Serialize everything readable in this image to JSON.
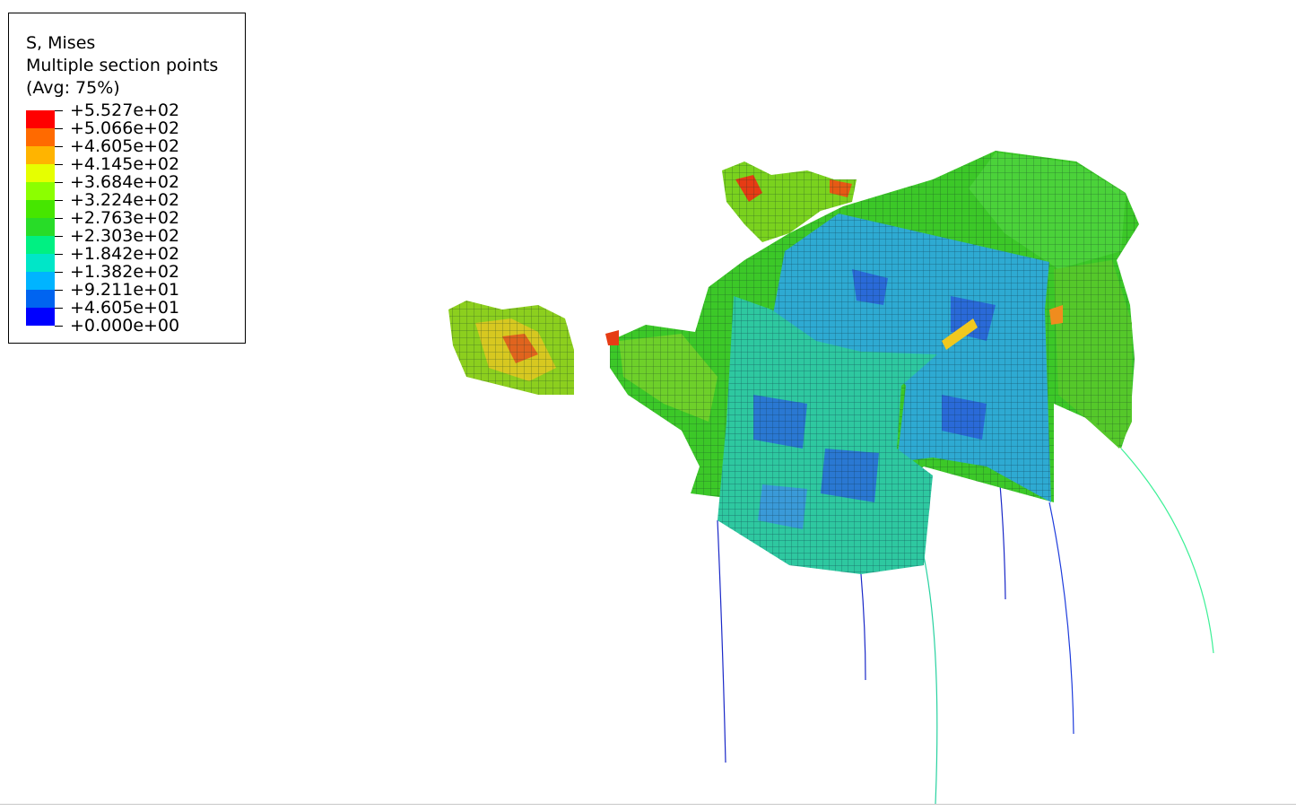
{
  "legend": {
    "title": "S, Mises",
    "subtitle": "Multiple section points",
    "avg": "(Avg: 75%)",
    "levels": [
      {
        "label": "+5.527e+02",
        "color": "#ff0000"
      },
      {
        "label": "+5.066e+02",
        "color": "#ff6a00"
      },
      {
        "label": "+4.605e+02",
        "color": "#ffb400"
      },
      {
        "label": "+4.145e+02",
        "color": "#e6ff00"
      },
      {
        "label": "+3.684e+02",
        "color": "#8cff00"
      },
      {
        "label": "+3.224e+02",
        "color": "#46e600"
      },
      {
        "label": "+2.763e+02",
        "color": "#28dc28"
      },
      {
        "label": "+2.303e+02",
        "color": "#00f082"
      },
      {
        "label": "+1.842e+02",
        "color": "#00e6c8"
      },
      {
        "label": "+1.382e+02",
        "color": "#00b4ff"
      },
      {
        "label": "+9.211e+01",
        "color": "#0064f0"
      },
      {
        "label": "+4.605e+01",
        "color": "#0000ff"
      },
      {
        "label": "+0.000e+00",
        "color": null
      }
    ]
  }
}
